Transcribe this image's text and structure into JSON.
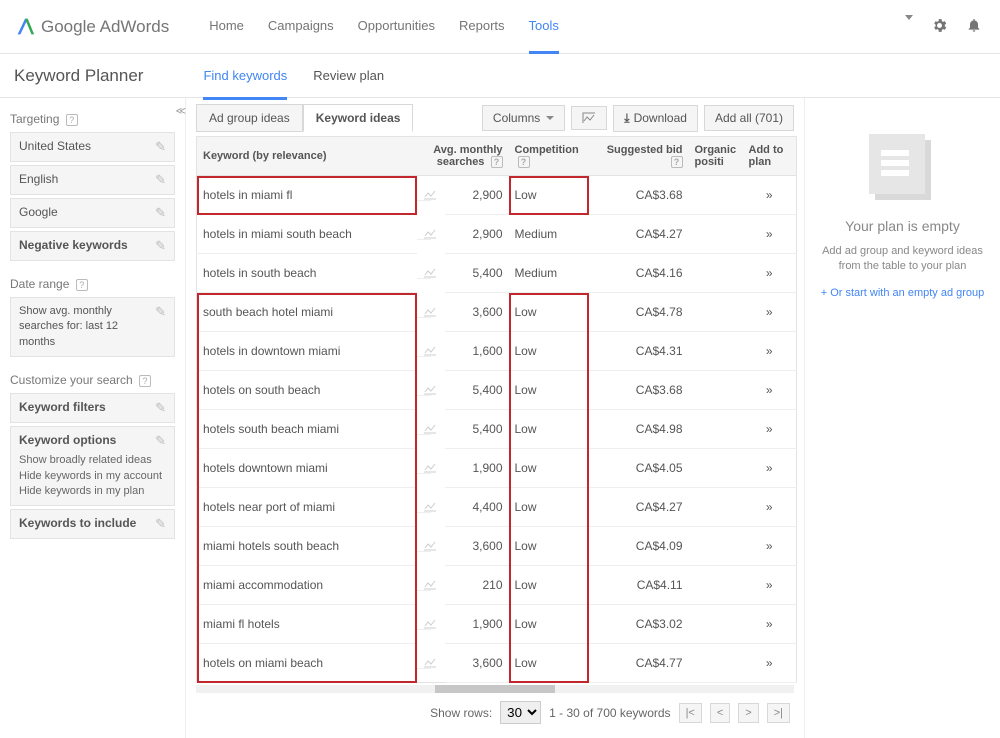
{
  "logo": "Google AdWords",
  "nav": [
    "Home",
    "Campaigns",
    "Opportunities",
    "Reports",
    "Tools"
  ],
  "nav_active": 4,
  "page_title": "Keyword Planner",
  "subtabs": [
    "Find keywords",
    "Review plan"
  ],
  "subtabs_active": 0,
  "sidebar": {
    "targeting_h": "Targeting",
    "targeting": [
      {
        "label": "United States",
        "bold": false
      },
      {
        "label": "English",
        "bold": false
      },
      {
        "label": "Google",
        "bold": false
      },
      {
        "label": "Negative keywords",
        "bold": true
      }
    ],
    "date_h": "Date range",
    "date_box": "Show avg. monthly searches for: last 12 months",
    "customize_h": "Customize your search",
    "kw_filters": "Keyword filters",
    "kw_opts_h": "Keyword options",
    "kw_opts": [
      "Show broadly related ideas",
      "Hide keywords in my account",
      "Hide keywords in my plan"
    ],
    "kw_include": "Keywords to include"
  },
  "main_tabs": [
    "Ad group ideas",
    "Keyword ideas"
  ],
  "main_tabs_active": 1,
  "toolbar": {
    "columns": "Columns",
    "download": "Download",
    "addall": "Add all (701)"
  },
  "headers": {
    "kw": "Keyword (by relevance)",
    "avg": "Avg. monthly searches",
    "comp": "Competition",
    "bid": "Suggested bid",
    "org": "Organic positi",
    "add": "Add to plan"
  },
  "rows": [
    {
      "kw": "hotels in miami fl",
      "avg": "2,900",
      "comp": "Low",
      "bid": "CA$3.68",
      "hl_kw": true,
      "hl_comp": true
    },
    {
      "kw": "hotels in miami south beach",
      "avg": "2,900",
      "comp": "Medium",
      "bid": "CA$4.27"
    },
    {
      "kw": "hotels in south beach",
      "avg": "5,400",
      "comp": "Medium",
      "bid": "CA$4.16"
    },
    {
      "kw": "south beach hotel miami",
      "avg": "3,600",
      "comp": "Low",
      "bid": "CA$4.78",
      "grp": true
    },
    {
      "kw": "hotels in downtown miami",
      "avg": "1,600",
      "comp": "Low",
      "bid": "CA$4.31",
      "grp": true
    },
    {
      "kw": "hotels on south beach",
      "avg": "5,400",
      "comp": "Low",
      "bid": "CA$3.68",
      "grp": true
    },
    {
      "kw": "hotels south beach miami",
      "avg": "5,400",
      "comp": "Low",
      "bid": "CA$4.98",
      "grp": true
    },
    {
      "kw": "hotels downtown miami",
      "avg": "1,900",
      "comp": "Low",
      "bid": "CA$4.05",
      "grp": true
    },
    {
      "kw": "hotels near port of miami",
      "avg": "4,400",
      "comp": "Low",
      "bid": "CA$4.27",
      "grp": true
    },
    {
      "kw": "miami hotels south beach",
      "avg": "3,600",
      "comp": "Low",
      "bid": "CA$4.09",
      "grp": true
    },
    {
      "kw": "miami accommodation",
      "avg": "210",
      "comp": "Low",
      "bid": "CA$4.11",
      "grp": true
    },
    {
      "kw": "miami fl hotels",
      "avg": "1,900",
      "comp": "Low",
      "bid": "CA$3.02",
      "grp": true
    },
    {
      "kw": "hotels on miami beach",
      "avg": "3,600",
      "comp": "Low",
      "bid": "CA$4.77",
      "grp": true
    }
  ],
  "pag": {
    "showrows": "Show rows:",
    "rows": "30",
    "range": "1 - 30 of 700 keywords"
  },
  "rpanel": {
    "h": "Your plan is empty",
    "t": "Add ad group and keyword ideas from the table to your plan",
    "link": "+ Or start with an empty ad group"
  }
}
